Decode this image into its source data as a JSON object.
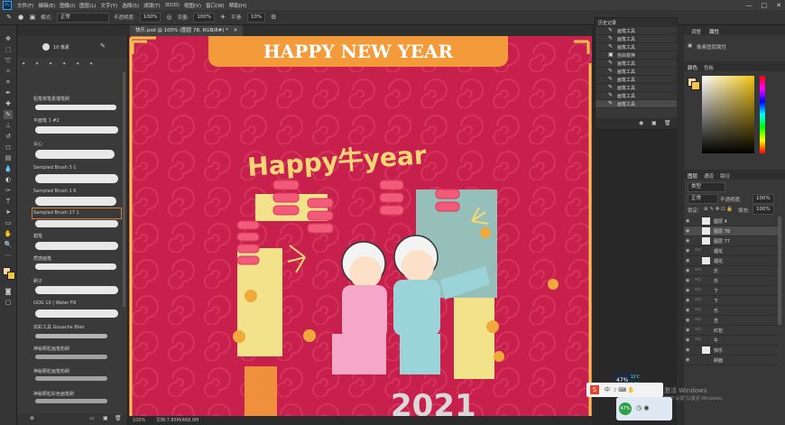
{
  "app": {
    "logo": "Ps",
    "menu": [
      "文件(F)",
      "编辑(E)",
      "图像(I)",
      "图层(L)",
      "文字(Y)",
      "选择(S)",
      "滤镜(T)",
      "3D(D)",
      "视图(V)",
      "窗口(W)",
      "帮助(H)"
    ],
    "window_controls": [
      "—",
      "□",
      "✕"
    ]
  },
  "options": {
    "mode_label": "模式:",
    "mode_value": "正常",
    "opacity_label": "不透明度:",
    "opacity_value": "100%",
    "flow_label": "流量:",
    "flow_value": "100%",
    "smooth_label": "平滑:",
    "smooth_value": "10%"
  },
  "document_tab": "快乐.psd @ 100% (图层 78, RGB/8#) *",
  "brush_panel": {
    "size_value": "10 像素",
    "brushes": [
      "铅笔炭笔素描笔刷",
      "平面笔 1 #2",
      "尖心",
      "Sampled Brush 3 1",
      "Sampled Brush 1 6",
      "Sampled Brush 17 1",
      "蜡笔",
      "质感画笔",
      "刷子",
      "GOG 10 | Water Fill",
      "炫彩工具 Gouache Blair",
      "神秘颗粒画笔粉刷",
      "神秘颗粒画笔粉刷",
      "神秘颗粒彩色画笔刷"
    ]
  },
  "canvas": {
    "banner_text": "HAPPY NEW YEAR",
    "handwritten_text": "Happy牛year",
    "year_text": "2021"
  },
  "status": {
    "zoom": "100%",
    "doc_info": "文档:7.85M/468.0M"
  },
  "history_panel": {
    "title": "历史记录",
    "items": [
      "画笔工具",
      "画笔工具",
      "画笔工具",
      "自由变换",
      "画笔工具",
      "画笔工具",
      "画笔工具",
      "画笔工具",
      "画笔工具",
      "画笔工具"
    ]
  },
  "right_panels": {
    "top_tabs": [
      "调整",
      "属性"
    ],
    "props_label": "像素图层属性",
    "color_tabs": [
      "颜色",
      "色板"
    ],
    "layers_tabs": [
      "图层",
      "通道",
      "路径"
    ],
    "filter_label": "类型",
    "blend_value": "正常",
    "opacity_label": "不透明度:",
    "opacity_value": "100%",
    "lock_label": "锁定:",
    "fill_label": "填充:",
    "fill_value": "100%",
    "layers": [
      "图层 4",
      "图层 78",
      "图层 77",
      "烟花",
      "烟花",
      "乐",
      "乐",
      "下",
      "下",
      "乐",
      "吉",
      "红包",
      "牛",
      "快乐",
      "斜面"
    ]
  },
  "overlays": {
    "cpu_percent": "47%",
    "temp": "15°C",
    "net": "0.1K/s",
    "widget_percent": "47%",
    "watermark_1": "激活 Windows",
    "watermark_2": "转到\"设置\"以激活 Windows。"
  },
  "colors": {
    "canvas_bg": "#c8204d",
    "banner_bg": "#f39a3a",
    "pink": "#f4a7c7",
    "teal": "#9ad3d8",
    "gold": "#f2c14e",
    "foreground_swatch": "#f1d8a0",
    "background_swatch": "#f4c542"
  }
}
